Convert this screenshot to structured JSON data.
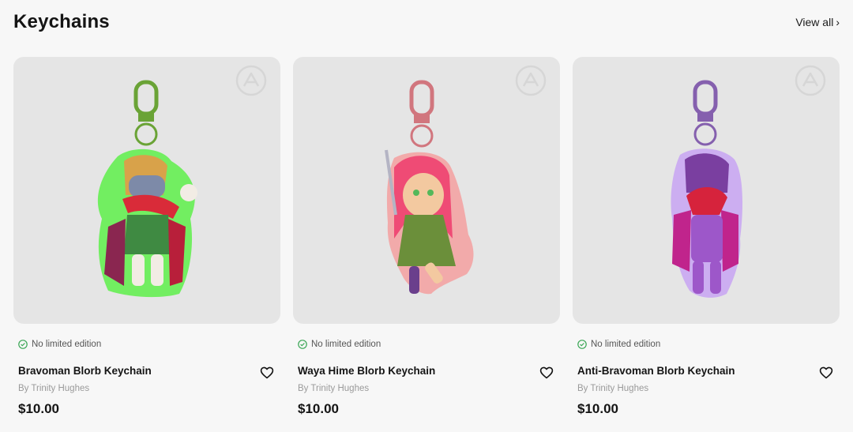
{
  "section": {
    "title": "Keychains",
    "view_all_label": "View all",
    "view_all_icon": "chevron-right-icon"
  },
  "products": [
    {
      "name": "Bravoman Blorb Keychain",
      "creator": "By Trinity Hughes",
      "price": "$10.00",
      "edition": "No limited edition",
      "clip_color": "#6aa336",
      "glow_color": "#5ef04a"
    },
    {
      "name": "Waya Hime Blorb Keychain",
      "creator": "By Trinity Hughes",
      "price": "$10.00",
      "edition": "No limited edition",
      "clip_color": "#d1767e",
      "glow_color": "#f3a3a3"
    },
    {
      "name": "Anti-Bravoman Blorb Keychain",
      "creator": "By Trinity Hughes",
      "price": "$10.00",
      "edition": "No limited edition",
      "clip_color": "#8560ae",
      "glow_color": "#c9a7f2"
    }
  ],
  "colors": {
    "edition_check": "#3aa655",
    "card_bg": "#e5e5e5"
  }
}
